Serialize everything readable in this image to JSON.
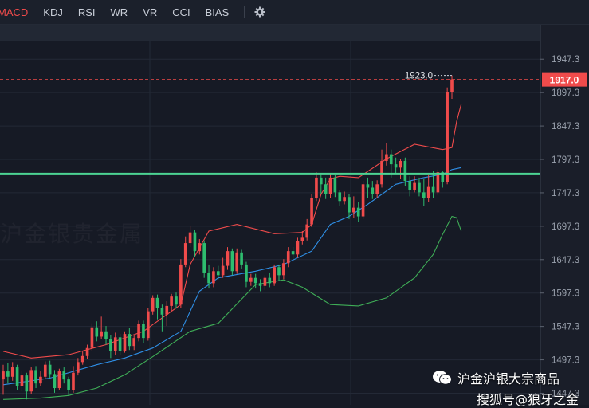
{
  "tabs": [
    "MACD",
    "KDJ",
    "RSI",
    "WR",
    "VR",
    "CCI",
    "BIAS"
  ],
  "active_tab": "MACD",
  "settings_icon": "gear-icon",
  "watermark_left": "沪金银贵金属",
  "watermark": {
    "line1": "沪金沪银大宗商品",
    "line2": "搜狐号@狼牙之金",
    "icon": "wechat-icon"
  },
  "colors": {
    "up": "#f04b4b",
    "down": "#2ebd6f",
    "ma_upper": "#f04b4b",
    "ma_middle": "#2f8fe6",
    "ma_lower": "#3fae57",
    "horizontal_line": "#4cd493",
    "price_line": "#f04b4b"
  },
  "chart_data": {
    "type": "candlestick",
    "y_ticks": [
      "1947.3",
      "1897.3",
      "1847.3",
      "1797.3",
      "1747.3",
      "1697.3",
      "1647.3",
      "1597.3",
      "1547.3",
      "1497.3",
      "1447.3"
    ],
    "ylim": [
      1430,
      1975
    ],
    "current_price": "1917.0",
    "high_label": "1923.0",
    "horizontal_line_value": 1776,
    "candles": [
      [
        1468,
        1480,
        1445,
        1490
      ],
      [
        1480,
        1472,
        1462,
        1493
      ],
      [
        1472,
        1486,
        1466,
        1494
      ],
      [
        1486,
        1458,
        1452,
        1490
      ],
      [
        1458,
        1474,
        1450,
        1480
      ],
      [
        1474,
        1450,
        1438,
        1478
      ],
      [
        1450,
        1482,
        1446,
        1486
      ],
      [
        1482,
        1462,
        1455,
        1488
      ],
      [
        1462,
        1472,
        1458,
        1480
      ],
      [
        1472,
        1490,
        1468,
        1495
      ],
      [
        1490,
        1476,
        1470,
        1496
      ],
      [
        1476,
        1455,
        1448,
        1482
      ],
      [
        1455,
        1480,
        1452,
        1484
      ],
      [
        1480,
        1468,
        1462,
        1486
      ],
      [
        1468,
        1452,
        1444,
        1472
      ],
      [
        1452,
        1478,
        1448,
        1488
      ],
      [
        1478,
        1494,
        1474,
        1500
      ],
      [
        1494,
        1503,
        1490,
        1510
      ],
      [
        1503,
        1515,
        1498,
        1520
      ],
      [
        1515,
        1546,
        1510,
        1552
      ],
      [
        1546,
        1532,
        1525,
        1555
      ],
      [
        1532,
        1540,
        1528,
        1562
      ],
      [
        1540,
        1528,
        1520,
        1548
      ],
      [
        1528,
        1510,
        1500,
        1534
      ],
      [
        1510,
        1531,
        1505,
        1538
      ],
      [
        1531,
        1510,
        1504,
        1536
      ],
      [
        1510,
        1536,
        1508,
        1540
      ],
      [
        1536,
        1518,
        1512,
        1545
      ],
      [
        1518,
        1530,
        1512,
        1535
      ],
      [
        1530,
        1551,
        1525,
        1556
      ],
      [
        1551,
        1530,
        1522,
        1556
      ],
      [
        1530,
        1570,
        1526,
        1575
      ],
      [
        1570,
        1590,
        1565,
        1594
      ],
      [
        1590,
        1575,
        1558,
        1595
      ],
      [
        1575,
        1565,
        1540,
        1580
      ],
      [
        1565,
        1578,
        1548,
        1585
      ],
      [
        1578,
        1592,
        1570,
        1596
      ],
      [
        1592,
        1580,
        1574,
        1598
      ],
      [
        1580,
        1640,
        1575,
        1648
      ],
      [
        1640,
        1672,
        1636,
        1682
      ],
      [
        1672,
        1688,
        1666,
        1698
      ],
      [
        1688,
        1660,
        1652,
        1692
      ],
      [
        1660,
        1672,
        1655,
        1678
      ],
      [
        1672,
        1628,
        1620,
        1676
      ],
      [
        1628,
        1612,
        1604,
        1640
      ],
      [
        1612,
        1630,
        1606,
        1636
      ],
      [
        1630,
        1624,
        1618,
        1638
      ],
      [
        1624,
        1638,
        1620,
        1650
      ],
      [
        1638,
        1660,
        1632,
        1666
      ],
      [
        1660,
        1630,
        1624,
        1664
      ],
      [
        1630,
        1658,
        1626,
        1664
      ],
      [
        1658,
        1640,
        1634,
        1662
      ],
      [
        1640,
        1614,
        1606,
        1644
      ],
      [
        1614,
        1620,
        1608,
        1626
      ],
      [
        1620,
        1612,
        1604,
        1626
      ],
      [
        1612,
        1608,
        1600,
        1618
      ],
      [
        1608,
        1620,
        1602,
        1624
      ],
      [
        1620,
        1612,
        1606,
        1628
      ],
      [
        1612,
        1636,
        1608,
        1640
      ],
      [
        1636,
        1624,
        1616,
        1640
      ],
      [
        1624,
        1642,
        1618,
        1648
      ],
      [
        1642,
        1660,
        1636,
        1666
      ],
      [
        1660,
        1655,
        1648,
        1666
      ],
      [
        1655,
        1675,
        1650,
        1680
      ],
      [
        1675,
        1680,
        1670,
        1690
      ],
      [
        1680,
        1700,
        1676,
        1708
      ],
      [
        1700,
        1740,
        1696,
        1746
      ],
      [
        1740,
        1770,
        1735,
        1778
      ],
      [
        1770,
        1760,
        1745,
        1775
      ],
      [
        1760,
        1745,
        1738,
        1770
      ],
      [
        1745,
        1770,
        1740,
        1776
      ],
      [
        1770,
        1748,
        1741,
        1774
      ],
      [
        1748,
        1735,
        1728,
        1752
      ],
      [
        1735,
        1741,
        1730,
        1749
      ],
      [
        1741,
        1718,
        1708,
        1746
      ],
      [
        1718,
        1725,
        1710,
        1742
      ],
      [
        1725,
        1712,
        1704,
        1734
      ],
      [
        1712,
        1760,
        1708,
        1765
      ],
      [
        1760,
        1755,
        1740,
        1770
      ],
      [
        1755,
        1745,
        1738,
        1765
      ],
      [
        1745,
        1760,
        1740,
        1766
      ],
      [
        1760,
        1795,
        1755,
        1812
      ],
      [
        1795,
        1805,
        1788,
        1822
      ],
      [
        1805,
        1790,
        1770,
        1812
      ],
      [
        1790,
        1785,
        1776,
        1800
      ],
      [
        1785,
        1795,
        1768,
        1798
      ],
      [
        1795,
        1765,
        1758,
        1800
      ],
      [
        1765,
        1752,
        1742,
        1772
      ],
      [
        1752,
        1762,
        1748,
        1772
      ],
      [
        1762,
        1748,
        1742,
        1770
      ],
      [
        1748,
        1740,
        1728,
        1768
      ],
      [
        1740,
        1756,
        1734,
        1774
      ],
      [
        1756,
        1748,
        1740,
        1780
      ],
      [
        1748,
        1778,
        1744,
        1782
      ],
      [
        1778,
        1763,
        1755,
        1780
      ],
      [
        1763,
        1898,
        1760,
        1905
      ],
      [
        1898,
        1917,
        1888,
        1923
      ]
    ],
    "ma_upper": [
      [
        0,
        1510
      ],
      [
        6,
        1500
      ],
      [
        14,
        1505
      ],
      [
        22,
        1520
      ],
      [
        30,
        1540
      ],
      [
        38,
        1580
      ],
      [
        40,
        1640
      ],
      [
        44,
        1690
      ],
      [
        50,
        1700
      ],
      [
        58,
        1686
      ],
      [
        64,
        1688
      ],
      [
        66,
        1700
      ],
      [
        68,
        1745
      ],
      [
        70,
        1768
      ],
      [
        72,
        1772
      ],
      [
        76,
        1770
      ],
      [
        82,
        1798
      ],
      [
        88,
        1820
      ],
      [
        94,
        1812
      ],
      [
        96,
        1815
      ],
      [
        97,
        1854
      ],
      [
        98,
        1880
      ]
    ],
    "ma_middle": [
      [
        0,
        1460
      ],
      [
        10,
        1470
      ],
      [
        20,
        1490
      ],
      [
        26,
        1500
      ],
      [
        32,
        1515
      ],
      [
        38,
        1540
      ],
      [
        42,
        1600
      ],
      [
        46,
        1620
      ],
      [
        54,
        1630
      ],
      [
        60,
        1640
      ],
      [
        66,
        1660
      ],
      [
        70,
        1700
      ],
      [
        74,
        1712
      ],
      [
        78,
        1730
      ],
      [
        84,
        1760
      ],
      [
        90,
        1770
      ],
      [
        94,
        1775
      ],
      [
        96,
        1782
      ],
      [
        98,
        1785
      ]
    ],
    "ma_lower": [
      [
        0,
        1438
      ],
      [
        8,
        1440
      ],
      [
        14,
        1444
      ],
      [
        20,
        1455
      ],
      [
        26,
        1475
      ],
      [
        32,
        1502
      ],
      [
        40,
        1540
      ],
      [
        46,
        1552
      ],
      [
        54,
        1610
      ],
      [
        60,
        1617
      ],
      [
        64,
        1606
      ],
      [
        70,
        1580
      ],
      [
        76,
        1578
      ],
      [
        82,
        1590
      ],
      [
        88,
        1620
      ],
      [
        92,
        1655
      ],
      [
        94,
        1685
      ],
      [
        96,
        1712
      ],
      [
        97,
        1710
      ],
      [
        98,
        1690
      ]
    ]
  }
}
